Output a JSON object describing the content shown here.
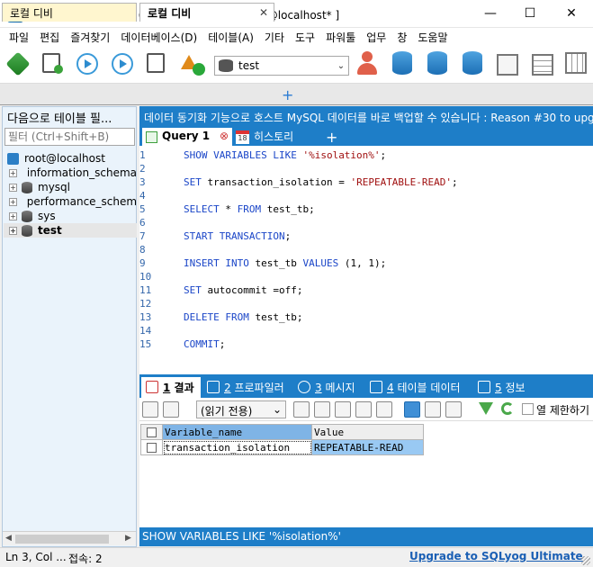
{
  "window": {
    "title": "SQLyog Community 64 - [로컬 디비/test - root@localhost* ]",
    "controls": {
      "minimize": "—",
      "maximize": "☐",
      "close": "✕"
    }
  },
  "menu": [
    "파일",
    "편집",
    "즐겨찾기",
    "데이터베이스(D)",
    "테이블(A)",
    "기타",
    "도구",
    "파워툴",
    "업무",
    "창",
    "도움말"
  ],
  "toolbar": {
    "database_selector": "test",
    "icons": [
      "new-connection-icon",
      "new-query-icon",
      "execute-query-icon",
      "execute-all-icon",
      "execute-explain-icon",
      "schema-designer-icon",
      "user-manager-icon",
      "backup-db-icon",
      "restore-db-icon",
      "sync-db-icon",
      "import-icon",
      "table-structure-icon",
      "data-sync-icon"
    ]
  },
  "connection_tabs": [
    {
      "label": "로컬 디비",
      "active": false
    },
    {
      "label": "로컬 디비",
      "active": true,
      "close": "✕"
    }
  ],
  "add_tab": "+",
  "object_browser": {
    "header": "다음으로 테이블 필...",
    "filter_placeholder": "필터 (Ctrl+Shift+B)",
    "root": "root@localhost",
    "databases": [
      {
        "name": "information_schema",
        "expander": "+"
      },
      {
        "name": "mysql",
        "expander": "+"
      },
      {
        "name": "performance_schema",
        "expander": "+"
      },
      {
        "name": "sys",
        "expander": "+"
      },
      {
        "name": "test",
        "expander": "+",
        "selected": true
      }
    ],
    "scroll_left": "◀",
    "scroll_right": "▶"
  },
  "banner": "데이터 동기화 기능으로 호스트 MySQL 데이터를 바로 백업할 수 있습니다 : Reason #30 to upg...",
  "editor_tabs": {
    "query": "Query 1",
    "query_close": "⊗",
    "history": "히스토리",
    "history_icon_text": "18",
    "add": "+"
  },
  "editor": {
    "line_numbers": [
      "1",
      "2",
      "3",
      "4",
      "5",
      "6",
      "7",
      "8",
      "9",
      "10",
      "11",
      "12",
      "13",
      "14",
      "15"
    ],
    "lines": [
      [
        {
          "t": "SHOW VARIABLES LIKE ",
          "c": "kw"
        },
        {
          "t": "'%isolation%'",
          "c": "str"
        },
        {
          "t": ";",
          "c": ""
        }
      ],
      [],
      [
        {
          "t": "SET",
          "c": "kw"
        },
        {
          "t": " transaction_isolation = ",
          "c": ""
        },
        {
          "t": "'REPEATABLE-READ'",
          "c": "str"
        },
        {
          "t": ";",
          "c": ""
        }
      ],
      [],
      [
        {
          "t": "SELECT",
          "c": "kw"
        },
        {
          "t": " * ",
          "c": ""
        },
        {
          "t": "FROM",
          "c": "kw"
        },
        {
          "t": " test_tb;",
          "c": ""
        }
      ],
      [],
      [
        {
          "t": "START TRANSACTION",
          "c": "kw"
        },
        {
          "t": ";",
          "c": ""
        }
      ],
      [],
      [
        {
          "t": "INSERT INTO",
          "c": "kw"
        },
        {
          "t": " test_tb ",
          "c": ""
        },
        {
          "t": "VALUES",
          "c": "kw"
        },
        {
          "t": " (1, 1);",
          "c": ""
        }
      ],
      [],
      [
        {
          "t": "SET",
          "c": "kw"
        },
        {
          "t": " autocommit =off;",
          "c": ""
        }
      ],
      [],
      [
        {
          "t": "DELETE FROM",
          "c": "kw"
        },
        {
          "t": " test_tb;",
          "c": ""
        }
      ],
      [],
      [
        {
          "t": "COMMIT",
          "c": "kw"
        },
        {
          "t": ";",
          "c": ""
        }
      ]
    ]
  },
  "result_tabs": [
    {
      "num": "1",
      "label": "결과",
      "active": true
    },
    {
      "num": "2",
      "label": "프로파일러"
    },
    {
      "num": "3",
      "label": "메시지"
    },
    {
      "num": "4",
      "label": "테이블 데이터"
    },
    {
      "num": "5",
      "label": "정보"
    }
  ],
  "result_toolbar": {
    "readonly_select": "(읽기 전용)",
    "limit_label": "열 제한하기"
  },
  "result_grid": {
    "columns": [
      "Variable_name",
      "Value"
    ],
    "rows": [
      [
        "transaction_isolation",
        "REPEATABLE-READ"
      ]
    ]
  },
  "info_bar": "SHOW VARIABLES LIKE '%isolation%'",
  "status": {
    "position": "Ln 3, Col ...",
    "connections": "접속: 2",
    "upgrade": "Upgrade to SQLyog Ultimate"
  },
  "colors": {
    "accent": "#1e7ec8",
    "keyword": "#1b46c8",
    "string": "#a01010",
    "selection": "#99c9f3"
  }
}
